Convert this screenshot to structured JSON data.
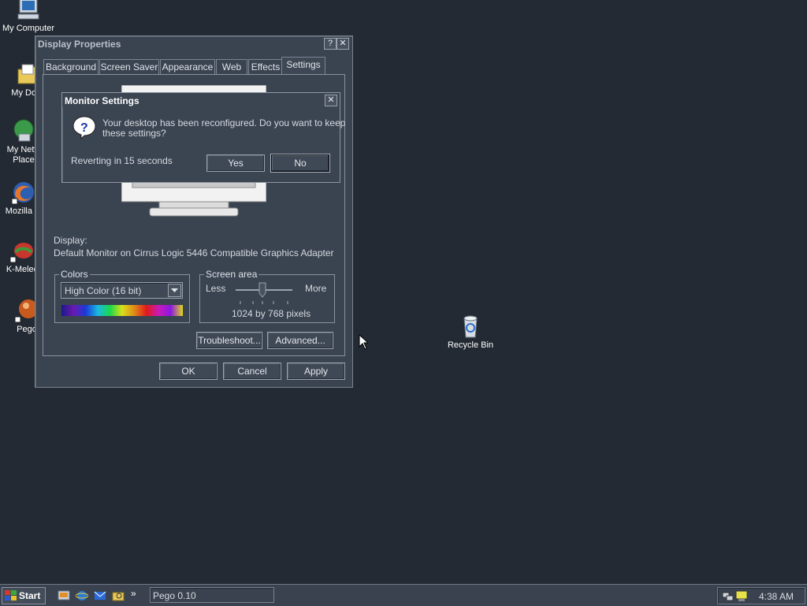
{
  "desktop": {
    "icons": [
      {
        "label": "My Computer",
        "icon": "my-computer-icon"
      },
      {
        "label": "My Docu",
        "icon": "my-documents-icon"
      },
      {
        "label": "My Netw",
        "label2": "Place",
        "icon": "network-places-icon"
      },
      {
        "label": "Mozilla Fi",
        "icon": "firefox-icon"
      },
      {
        "label": "K-Melec",
        "icon": "k-meleon-icon"
      },
      {
        "label": "Pego",
        "icon": "pego-icon"
      },
      {
        "label": "Recycle Bin",
        "icon": "recycle-bin-icon"
      }
    ]
  },
  "display_properties": {
    "title": "Display Properties",
    "help_btn": "?",
    "close_btn": "✕",
    "tabs": [
      "Background",
      "Screen Saver",
      "Appearance",
      "Web",
      "Effects",
      "Settings"
    ],
    "active_tab": "Settings",
    "display_label": "Display:",
    "display_value": "Default Monitor on Cirrus Logic 5446 Compatible Graphics Adapter",
    "colors_group": "Colors",
    "colors_value": "High Color (16 bit)",
    "screen_area_group": "Screen area",
    "less": "Less",
    "more": "More",
    "resolution": "1024 by 768 pixels",
    "troubleshoot": "Troubleshoot...",
    "advanced": "Advanced...",
    "ok": "OK",
    "cancel": "Cancel",
    "apply": "Apply"
  },
  "monitor_settings": {
    "title": "Monitor Settings",
    "close_btn": "✕",
    "message_line1": "Your desktop has been reconfigured.  Do you want to keep",
    "message_line2": "these settings?",
    "revert": "Reverting in 15 seconds",
    "yes": "Yes",
    "no": "No"
  },
  "taskbar": {
    "start": "Start",
    "chevron": "»",
    "task": "Pego 0.10",
    "clock": "4:38 AM"
  },
  "colors": {
    "desktop_bg": "#232a33",
    "window_bg": "#3a4350"
  }
}
